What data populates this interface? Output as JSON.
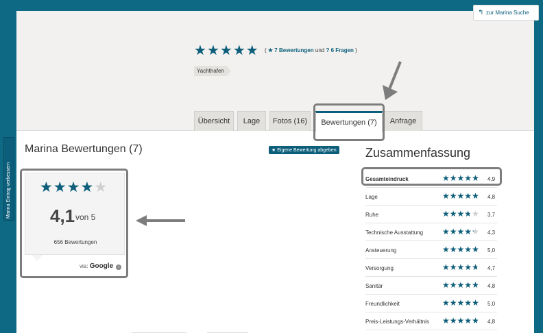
{
  "header": {
    "rating": 5,
    "reviews_link": "7 Bewertungen",
    "und": "und",
    "questions_link": "6 Fragen",
    "tag": "Yachthafen"
  },
  "tabs": [
    {
      "label": "Übersicht",
      "active": false
    },
    {
      "label": "Lage",
      "active": false
    },
    {
      "label": "Fotos (16)",
      "active": false
    },
    {
      "label": "Bewertungen (7)",
      "active": true
    },
    {
      "label": "Anfrage",
      "active": false
    }
  ],
  "main": {
    "title": "Marina Bewertungen (7)",
    "rate_button": "Eigene Bewertung abgeben"
  },
  "google": {
    "rating": 4.1,
    "score_text": "4,1",
    "von": "von 5",
    "reviews": "656 Bewertungen",
    "via_label": "via:",
    "source": "Google"
  },
  "summary": {
    "title": "Zusammenfassung",
    "rows": [
      {
        "label": "Gesamteindruck",
        "value": "4,9",
        "rating": 4.9
      },
      {
        "label": "Lage",
        "value": "4,8",
        "rating": 4.8
      },
      {
        "label": "Ruhe",
        "value": "3,7",
        "rating": 3.7
      },
      {
        "label": "Technische Ausstattung",
        "value": "4,3",
        "rating": 4.3
      },
      {
        "label": "Ansteuerung",
        "value": "5,0",
        "rating": 5.0
      },
      {
        "label": "Versorgung",
        "value": "4,7",
        "rating": 4.7
      },
      {
        "label": "Sanitär",
        "value": "4,8",
        "rating": 4.8
      },
      {
        "label": "Freundlichkeit",
        "value": "5,0",
        "rating": 5.0
      },
      {
        "label": "Preis-Leistungs-Verhältnis",
        "value": "4,8",
        "rating": 4.8
      }
    ]
  },
  "side_tab": "Marina Eintrag verbessern",
  "back_button": "zur Marina Suche",
  "colors": {
    "accent": "#0c5e7a",
    "frame": "#0e6a84",
    "callout": "#7d7d7d"
  }
}
